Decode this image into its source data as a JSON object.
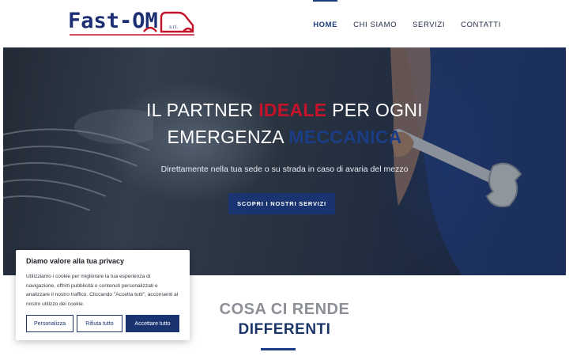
{
  "brand": {
    "logo_text": "Fast-OM",
    "logo_suffix": "s.r.l.",
    "colors": {
      "primary": "#1a3471",
      "accent_red": "#c4132a"
    }
  },
  "nav": {
    "items": [
      {
        "label": "HOME",
        "active": true
      },
      {
        "label": "CHI SIAMO",
        "active": false
      },
      {
        "label": "SERVIZI",
        "active": false
      },
      {
        "label": "CONTATTI",
        "active": false
      }
    ]
  },
  "hero": {
    "title_part1": "IL PARTNER ",
    "title_highlight1": "IDEALE",
    "title_part2": " PER OGNI",
    "title_part3": "EMERGENZA ",
    "title_highlight2": "MECCANICA",
    "subtitle": "Direttamente nella tua sede o su strada in caso di avaria del mezzo",
    "cta_label": "SCOPRI I NOSTRI SERVIZI"
  },
  "section": {
    "title": "COSA CI RENDE",
    "subtitle": "DIFFERENTI"
  },
  "cookie": {
    "title": "Diamo valore alla tua privacy",
    "text": "Utilizziamo i cookie per migliorare la tua esperienza di navigazione, offrirti pubblicità o contenuti personalizzati e analizzare il nostro traffico. Cliccando \"Accetta tutti\", acconsenti al nostro utilizzo dei cookie.",
    "btn_customize": "Personalizza",
    "btn_reject": "Rifiuta tutto",
    "btn_accept": "Accettare tutto"
  }
}
